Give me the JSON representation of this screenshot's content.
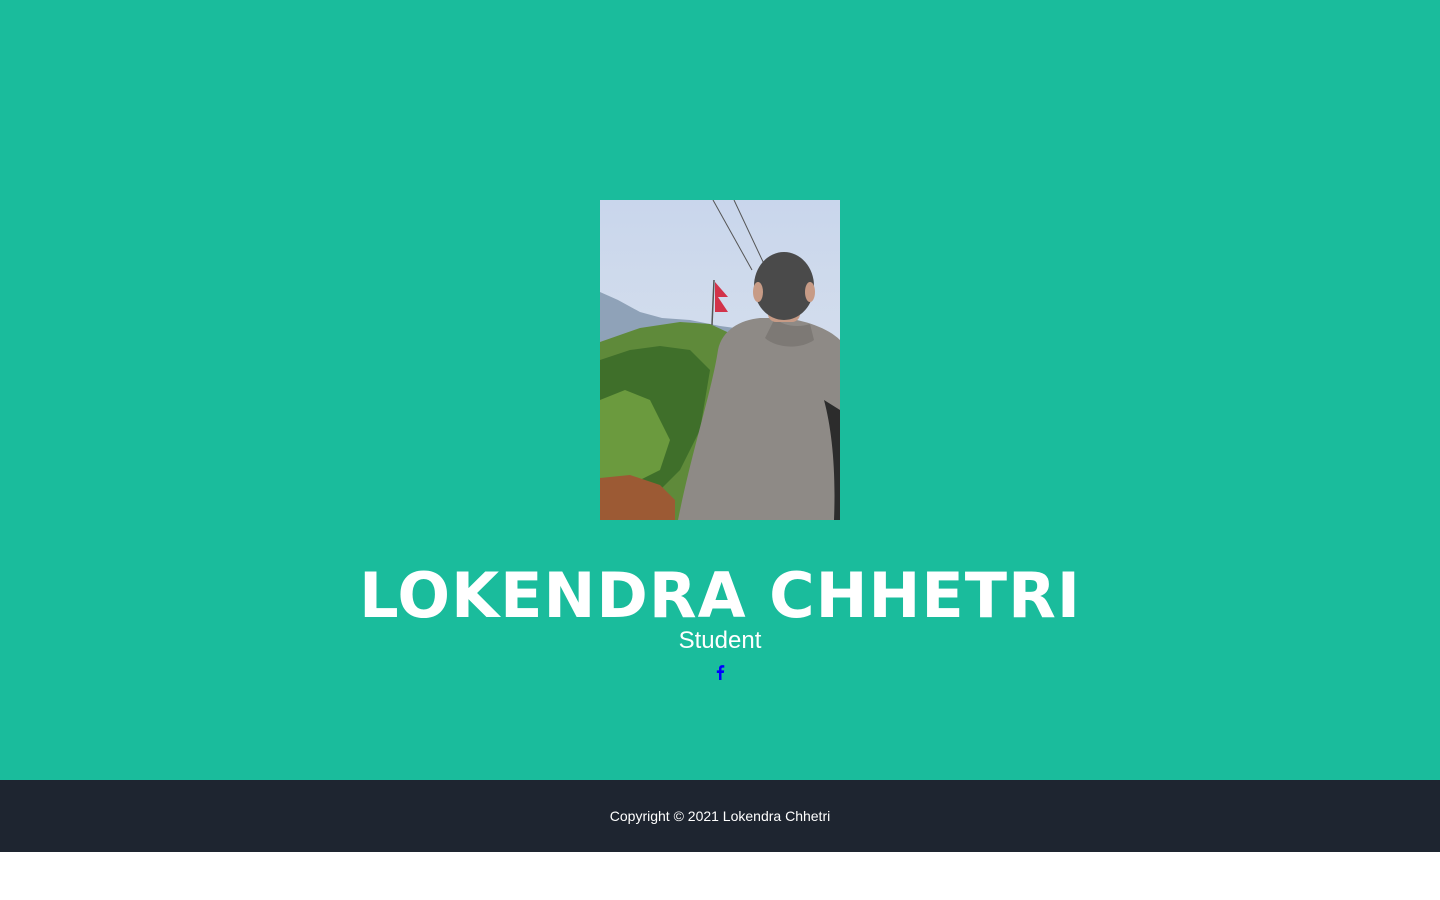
{
  "profile": {
    "name": "LOKENDRA CHHETRI",
    "role": "Student"
  },
  "social": {
    "icon": "facebook-icon",
    "color": "#0000ff"
  },
  "footer": {
    "copyright": "Copyright © 2021 Lokendra Chhetri"
  },
  "colors": {
    "hero_background": "#1abc9c",
    "footer_background": "#1e2530",
    "text": "#ffffff"
  }
}
